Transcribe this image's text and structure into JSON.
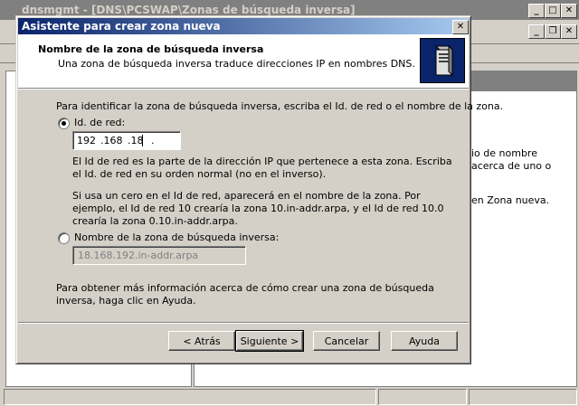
{
  "background_window": {
    "title": "dnsmgmt - [DNS\\PCSWAP\\Zonas de búsqueda inversa]",
    "right_pane_text_1": "io de nombre acerca de uno o",
    "right_pane_text_2": "en Zona nueva."
  },
  "dialog": {
    "title": "Asistente para crear zona nueva",
    "close_glyph": "✕",
    "header": {
      "title": "Nombre de la zona de búsqueda inversa",
      "subtitle": "Una zona de búsqueda inversa traduce direcciones IP en nombres DNS."
    },
    "intro": "Para identificar la zona de búsqueda inversa, escriba el Id. de red o el nombre de la zona.",
    "option_network_id": {
      "label": "Id. de red:",
      "selected": true,
      "octets": [
        "192",
        ".168",
        ".18",
        "."
      ]
    },
    "network_id_help_1": "El Id de red es la parte de la dirección IP que pertenece a esta zona. Escriba el Id. de red en su orden normal (no en el inverso).",
    "network_id_help_2": "Si usa un cero en el Id de red, aparecerá en el nombre de la zona.  Por ejemplo, el Id de red 10 crearía la zona 10.in-addr.arpa, y el Id de red 10.0 crearía la zona 0.10.in-addr.arpa.",
    "option_zone_name": {
      "label": "Nombre de la zona de búsqueda inversa:",
      "selected": false,
      "value": "18.168.192.in-addr.arpa"
    },
    "footer_text": "Para obtener más información acerca de cómo crear una zona de búsqueda inversa, haga clic en Ayuda.",
    "buttons": {
      "back": "< Atrás",
      "next": "Siguiente >",
      "cancel": "Cancelar",
      "help": "Ayuda"
    }
  },
  "colors": {
    "dialog_face": "#d4d0c8",
    "titlebar_active": "#0a246a",
    "titlebar_gradient_end": "#a6caf0"
  }
}
